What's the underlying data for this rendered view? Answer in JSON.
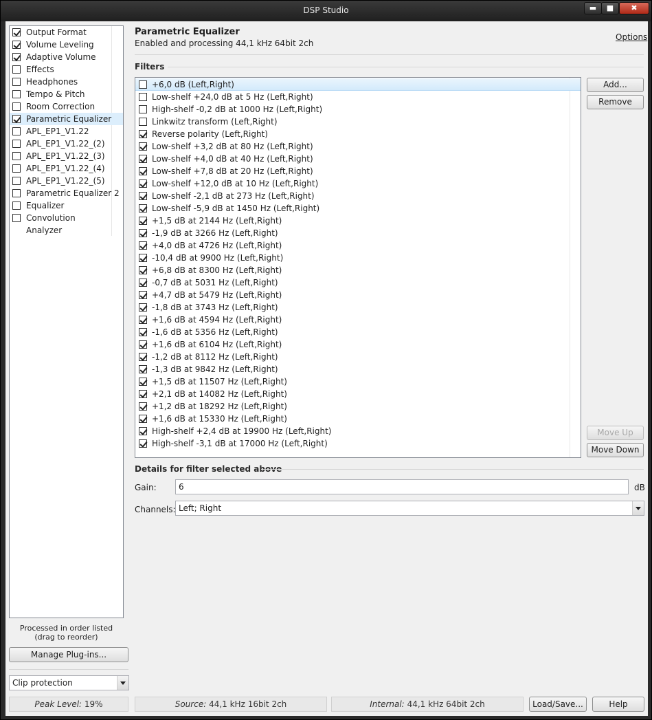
{
  "window": {
    "title": "DSP Studio",
    "min_glyph": "▬",
    "max_glyph": "■",
    "close_glyph": "✖"
  },
  "left_panel": {
    "items": [
      {
        "label": "Output Format",
        "checked": true
      },
      {
        "label": "Volume Leveling",
        "checked": true
      },
      {
        "label": "Adaptive Volume",
        "checked": true
      },
      {
        "label": "Effects",
        "checked": false
      },
      {
        "label": "Headphones",
        "checked": false
      },
      {
        "label": "Tempo & Pitch",
        "checked": false
      },
      {
        "label": "Room Correction",
        "checked": false
      },
      {
        "label": "Parametric Equalizer",
        "checked": true,
        "selected": true
      },
      {
        "label": "APL_EP1_V1.22",
        "checked": false
      },
      {
        "label": "APL_EP1_V1.22_(2)",
        "checked": false
      },
      {
        "label": "APL_EP1_V1.22_(3)",
        "checked": false
      },
      {
        "label": "APL_EP1_V1.22_(4)",
        "checked": false
      },
      {
        "label": "APL_EP1_V1.22_(5)",
        "checked": false
      },
      {
        "label": "Parametric Equalizer 2",
        "checked": false
      },
      {
        "label": "Equalizer",
        "checked": false
      },
      {
        "label": "Convolution",
        "checked": false
      },
      {
        "label": "Analyzer",
        "checked": null
      }
    ],
    "note": "Processed in order listed (drag to reorder)",
    "manage_plugins_label": "Manage Plug-ins...",
    "clip_protection_value": "Clip protection"
  },
  "main": {
    "title": "Parametric Equalizer",
    "subtitle": "Enabled and processing 44,1 kHz 64bit 2ch",
    "options_label": "Options",
    "filters_heading": "Filters",
    "filters": [
      {
        "label": "+6,0 dB (Left,Right)",
        "checked": false,
        "selected": true
      },
      {
        "label": "Low-shelf +24,0 dB at 5 Hz (Left,Right)",
        "checked": false
      },
      {
        "label": "High-shelf -0,2 dB at 1000 Hz (Left,Right)",
        "checked": false
      },
      {
        "label": "Linkwitz transform (Left,Right)",
        "checked": false
      },
      {
        "label": "Reverse polarity (Left,Right)",
        "checked": true
      },
      {
        "label": "Low-shelf +3,2 dB at 80 Hz (Left,Right)",
        "checked": true
      },
      {
        "label": "Low-shelf +4,0 dB at 40 Hz (Left,Right)",
        "checked": true
      },
      {
        "label": "Low-shelf +7,8 dB at 20 Hz (Left,Right)",
        "checked": true
      },
      {
        "label": "Low-shelf +12,0 dB at 10 Hz (Left,Right)",
        "checked": true
      },
      {
        "label": "Low-shelf -2,1 dB at 273 Hz (Left,Right)",
        "checked": true
      },
      {
        "label": "Low-shelf -5,9 dB at 1450 Hz (Left,Right)",
        "checked": true
      },
      {
        "label": "+1,5 dB at 2144 Hz (Left,Right)",
        "checked": true
      },
      {
        "label": "-1,9 dB at 3266 Hz (Left,Right)",
        "checked": true
      },
      {
        "label": "+4,0 dB at 4726 Hz (Left,Right)",
        "checked": true
      },
      {
        "label": "-10,4 dB at 9900 Hz (Left,Right)",
        "checked": true
      },
      {
        "label": "+6,8 dB at 8300 Hz (Left,Right)",
        "checked": true
      },
      {
        "label": "-0,7 dB at 5031 Hz (Left,Right)",
        "checked": true
      },
      {
        "label": "+4,7 dB at 5479 Hz (Left,Right)",
        "checked": true
      },
      {
        "label": "-1,8 dB at 3743 Hz (Left,Right)",
        "checked": true
      },
      {
        "label": "+1,6 dB at 4594 Hz (Left,Right)",
        "checked": true
      },
      {
        "label": "-1,6 dB at 5356 Hz (Left,Right)",
        "checked": true
      },
      {
        "label": "+1,6 dB at 6104 Hz (Left,Right)",
        "checked": true
      },
      {
        "label": "-1,2 dB at 8112 Hz (Left,Right)",
        "checked": true
      },
      {
        "label": "-1,3 dB at 9842 Hz (Left,Right)",
        "checked": true
      },
      {
        "label": "+1,5 dB at 11507 Hz (Left,Right)",
        "checked": true
      },
      {
        "label": "+2,1 dB at 14082 Hz (Left,Right)",
        "checked": true
      },
      {
        "label": "+1,2 dB at 18292 Hz (Left,Right)",
        "checked": true
      },
      {
        "label": "+1,6 dB at 15330 Hz (Left,Right)",
        "checked": true
      },
      {
        "label": "High-shelf +2,4 dB at 19900 Hz (Left,Right)",
        "checked": true
      },
      {
        "label": "High-shelf -3,1 dB at 17000 Hz (Left,Right)",
        "checked": true
      }
    ],
    "add_label": "Add...",
    "remove_label": "Remove",
    "move_up_label": "Move Up",
    "move_down_label": "Move Down",
    "details_heading": "Details for filter selected above",
    "gain_label": "Gain:",
    "gain_value": "6",
    "gain_unit": "dB",
    "channels_label": "Channels:",
    "channels_value": "Left; Right"
  },
  "status": {
    "peak_label": "Peak Level:",
    "peak_value": "19%",
    "source_label": "Source:",
    "source_value": "44,1 kHz 16bit 2ch",
    "internal_label": "Internal:",
    "internal_value": "44,1 kHz 64bit 2ch",
    "load_save_label": "Load/Save...",
    "help_label": "Help"
  }
}
